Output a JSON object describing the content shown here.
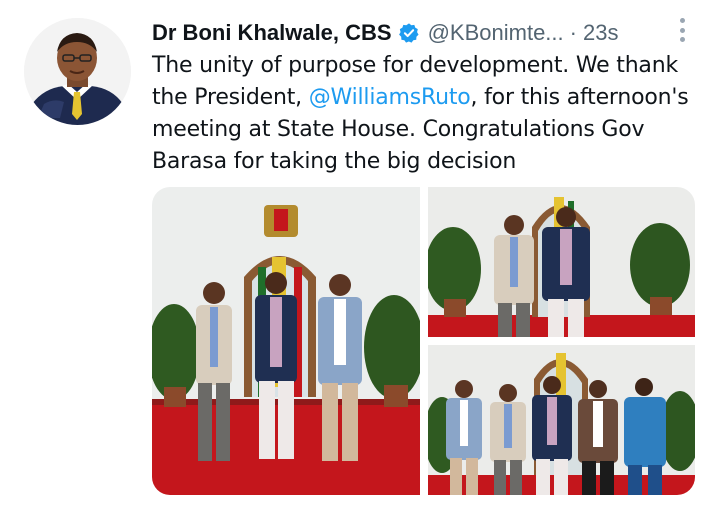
{
  "tweet": {
    "author_name": "Dr Boni Khalwale, CBS",
    "handle": "@KBonimte...",
    "separator": "·",
    "time": "23s",
    "text_lines": [
      {
        "before": "The unity of purpose for development. We thank",
        "mention": "",
        "after": ""
      },
      {
        "before": "the President, ",
        "mention": "@WilliamsRuto",
        "after": ", for this afternoon's"
      },
      {
        "before": "meeting at State House. Congratulations  Gov",
        "mention": "",
        "after": ""
      },
      {
        "before": "Barasa for taking the big decision",
        "mention": "",
        "after": ""
      }
    ]
  },
  "icons": {
    "verified": "verified-badge-icon",
    "more": "more-options-icon"
  },
  "colors": {
    "accent": "#1d9bf0",
    "secondary_text": "#536471",
    "carpet": "#c4161c",
    "wall": "#eef0ef"
  },
  "media": {
    "photo_count": 3
  }
}
